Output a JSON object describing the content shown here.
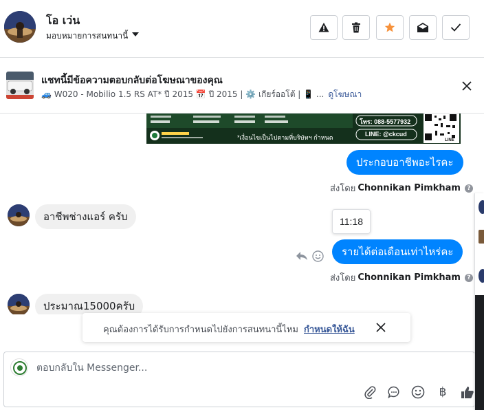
{
  "header": {
    "name": "โอ เว่น",
    "assign_label": "มอบหมายการสนทนานี้",
    "buttons": {
      "spam": "spam-icon",
      "delete": "trash-icon",
      "star": "star-icon",
      "unread": "envelope-open-icon",
      "done": "check-icon"
    },
    "star_color": "#f7923b"
  },
  "ad_banner": {
    "title": "แชทนี้มีข้อความตอบกลับต่อโฆษณาของคุณ",
    "meta": "🚙 W020 - Mobilio 1.5 RS AT* ปี 2015 📅 ปี 2015 | ⚙️ เกียร์ออโต้ | 📱 ...",
    "link": "ดูโฆษณา"
  },
  "promo_image": {
    "phone": "โทร: 088-5577932",
    "line": "LINE: @ckcud",
    "caption": "*เงื่อนไขเป็นไปตามที่บริษัทฯ กำหนด",
    "qr_label": "LINE"
  },
  "messages": [
    {
      "direction": "out",
      "text": "ประกอบอาชีพอะไรคะ",
      "sent_by_prefix": "ส่งโดย",
      "sender": "Chonnikan Pimkham"
    },
    {
      "direction": "in",
      "text": "อาชีพช่างแอร์ ครับ"
    },
    {
      "direction": "out",
      "text": "รายได้ต่อเดือนเท่าไหร่คะ",
      "sent_by_prefix": "ส่งโดย",
      "sender": "Chonnikan Pimkham",
      "tooltip_time": "11:18"
    },
    {
      "direction": "in",
      "text": "ประมาณ15000ครับ"
    }
  ],
  "notice": {
    "text": "คุณต้องการได้รับการกำหนดไปยังการสนทนานี้ไหม",
    "link": "กำหนดให้ฉัน"
  },
  "composer": {
    "placeholder": "ตอบกลับใน Messenger...",
    "tools": [
      "paperclip-icon",
      "saved-reply-icon",
      "emoji-icon",
      "baht-icon",
      "thumbs-up-icon"
    ],
    "currency_symbol": "฿"
  },
  "colors": {
    "accent_blue": "#0084ff",
    "link_blue": "#385898",
    "incoming_bubble": "#f0f0f0"
  }
}
